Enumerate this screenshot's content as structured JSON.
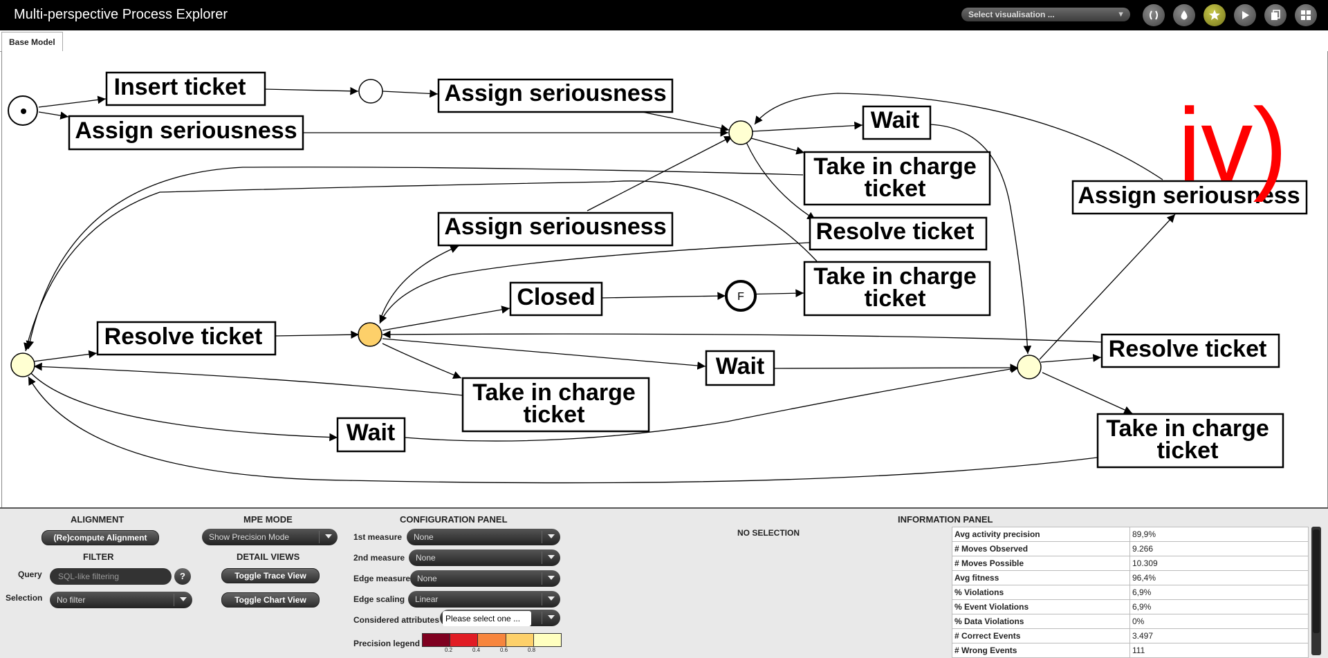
{
  "app": {
    "title": "Multi-perspective Process Explorer"
  },
  "toolbar": {
    "select_visualisation": "Select visualisation ...",
    "buttons": [
      {
        "icon": "brackets-icon"
      },
      {
        "icon": "drop-icon"
      },
      {
        "icon": "star-icon",
        "active": true
      },
      {
        "icon": "play-icon"
      },
      {
        "icon": "copy-icon"
      },
      {
        "icon": "grid-icon"
      }
    ]
  },
  "tabs": [
    {
      "label": "Base Model"
    }
  ],
  "model": {
    "annotation": "iv)",
    "annotation_color": "#ff0000",
    "place_colors": {
      "empty": "#ffffff",
      "light": "#ffffd2",
      "orange": "#fdd06a"
    },
    "start_symbol": "•",
    "final_symbol": "F",
    "activities": {
      "insert_ticket": "Insert ticket",
      "assign_seriousness": "Assign seriousness",
      "wait": "Wait",
      "take_in_charge_line1": "Take in charge",
      "take_in_charge_line2": "ticket",
      "resolve_ticket": "Resolve ticket",
      "closed": "Closed"
    }
  },
  "help_corner": "?",
  "alignment": {
    "title": "ALIGNMENT",
    "recompute_label": "(Re)compute Alignment"
  },
  "filter": {
    "title": "FILTER",
    "query_label": "Query",
    "query_placeholder": "SQL-like filtering",
    "help": "?",
    "selection_label": "Selection",
    "selection_value": "No filter"
  },
  "mpe_mode": {
    "title": "MPE MODE",
    "value": "Show Precision Mode"
  },
  "detail_views": {
    "title": "DETAIL VIEWS",
    "trace_label": "Toggle Trace View",
    "chart_label": "Toggle Chart View"
  },
  "config": {
    "title": "CONFIGURATION PANEL",
    "first_measure_label": "1st measure",
    "first_measure_value": "None",
    "second_measure_label": "2nd measure",
    "second_measure_value": "None",
    "edge_measure_label": "Edge measure",
    "edge_measure_value": "None",
    "edge_scaling_label": "Edge scaling",
    "edge_scaling_value": "Linear",
    "attributes_label": "Considered attributes",
    "attributes_value": "Please select one ...",
    "legend_label": "Precision legend",
    "legend_colors": [
      "#7f0020",
      "#e11c24",
      "#f7853d",
      "#fdd06a",
      "#ffffbf"
    ],
    "legend_ticks": [
      "0.2",
      "0.4",
      "0.6",
      "0.8"
    ]
  },
  "info": {
    "title": "INFORMATION PANEL",
    "no_selection": "NO SELECTION",
    "rows": [
      {
        "key": "Avg activity precision",
        "value": "89,9%"
      },
      {
        "key": "# Moves Observed",
        "value": "9.266"
      },
      {
        "key": "# Moves Possible",
        "value": "10.309"
      },
      {
        "key": "Avg fitness",
        "value": "96,4%"
      },
      {
        "key": "% Violations",
        "value": "6,9%"
      },
      {
        "key": "% Event Violations",
        "value": "6,9%"
      },
      {
        "key": "% Data Violations",
        "value": "0%"
      },
      {
        "key": "# Correct Events",
        "value": "3.497"
      },
      {
        "key": "# Wrong Events",
        "value": "111"
      }
    ]
  }
}
